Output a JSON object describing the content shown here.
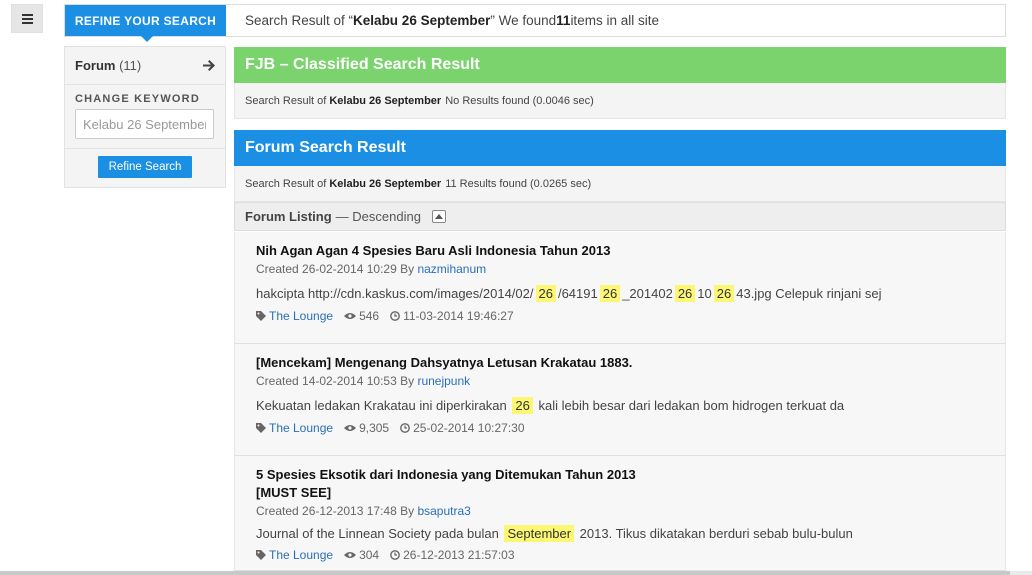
{
  "menu": {
    "icon": "hamburger-icon"
  },
  "search_bar": {
    "refine_tab": "REFINE YOUR SEARCH",
    "summary_prefix": "Search Result of “",
    "summary_keyword": "Kelabu 26 September",
    "summary_mid": "” We found ",
    "summary_count": "11",
    "summary_suffix": " items in all site"
  },
  "sidebar": {
    "forum_label": "Forum",
    "forum_count": "(11)",
    "change_keyword_title": "CHANGE KEYWORD",
    "keyword_value": "Kelabu 26 September",
    "refine_button": "Refine Search"
  },
  "fjb": {
    "title": "FJB – Classified Search Result",
    "sub_prefix": "Search Result of",
    "sub_keyword": "Kelabu 26 September",
    "sub_result": "No Results found (0.0046 sec)",
    "accent": "#7bd36e"
  },
  "forum_result": {
    "title": "Forum Search Result",
    "sub_prefix": "Search Result of",
    "sub_keyword": "Kelabu 26 September",
    "sub_result": "11 Results found (0.0265 sec)",
    "accent": "#1a8fe3"
  },
  "listing": {
    "label": "Forum Listing",
    "sort": "— Descending"
  },
  "items": [
    {
      "title": "Nih Agan Agan 4 Spesies Baru Asli Indonesia Tahun 2013",
      "created_prefix": "Created 26-02-2014 10:29 By ",
      "author": "nazmihanum",
      "snippet": [
        {
          "t": "hakcipta http://cdn.kaskus.com/images/2014/02/"
        },
        {
          "t": "26",
          "hl": true
        },
        {
          "t": "/64191"
        },
        {
          "t": "26",
          "hl": true
        },
        {
          "t": "_201402"
        },
        {
          "t": "26",
          "hl": true
        },
        {
          "t": "10"
        },
        {
          "t": "26",
          "hl": true
        },
        {
          "t": "43.jpg Celepuk rinjani sej"
        }
      ],
      "category": "The Lounge",
      "views": "546",
      "last_post": "11-03-2014 19:46:27"
    },
    {
      "title": "[Mencekam] Mengenang Dahsyatnya Letusan Krakatau 1883.",
      "created_prefix": "Created 14-02-2014 10:53 By ",
      "author": "runejpunk",
      "snippet": [
        {
          "t": "Kekuatan ledakan Krakatau ini diperkirakan "
        },
        {
          "t": "26",
          "hl": true
        },
        {
          "t": " kali lebih besar dari ledakan bom hidrogen terkuat da"
        }
      ],
      "category": "The Lounge",
      "views": "9,305",
      "last_post": "25-02-2014 10:27:30"
    },
    {
      "title": "5 Spesies Eksotik dari Indonesia yang Ditemukan Tahun 2013",
      "title_line2": "[MUST SEE]",
      "created_prefix": "Created 26-12-2013 17:48 By ",
      "author": "bsaputra3",
      "snippet": [
        {
          "t": "Journal of the Linnean Society pada bulan "
        },
        {
          "t": "September",
          "hl": true
        },
        {
          "t": " 2013. Tikus dikatakan berduri sebab bulu-bulun"
        }
      ],
      "category": "The Lounge",
      "views": "304",
      "last_post": "26-12-2013 21:57:03"
    }
  ]
}
